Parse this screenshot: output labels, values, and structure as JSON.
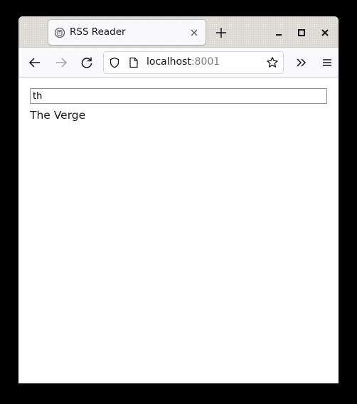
{
  "browser": {
    "tab": {
      "title": "RSS Reader"
    },
    "url": {
      "host": "localhost",
      "port": ":8001"
    }
  },
  "page": {
    "search": {
      "value": "th",
      "placeholder": ""
    },
    "results": [
      {
        "label": "The Verge"
      }
    ]
  }
}
